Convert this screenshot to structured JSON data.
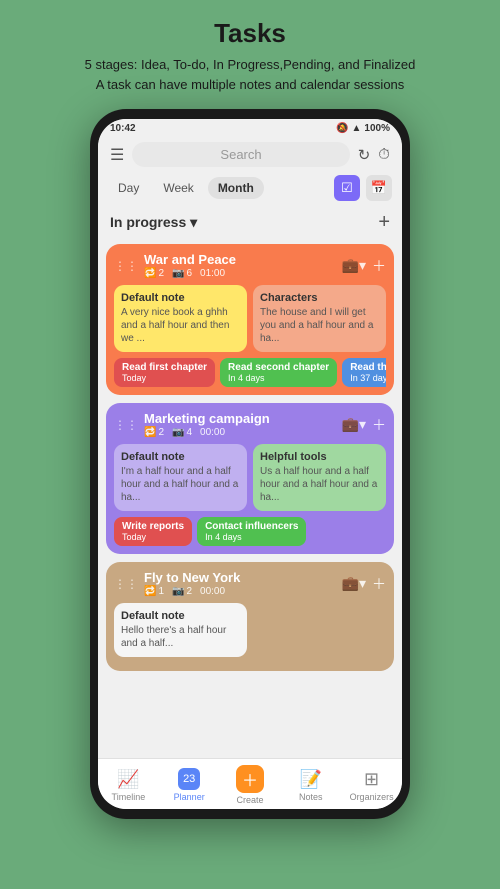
{
  "header": {
    "title": "Tasks",
    "subtitle_line1": "5 stages: Idea, To-do, In Progress,Pending, and Finalized",
    "subtitle_line2": "A task can have multiple notes and calendar sessions"
  },
  "status_bar": {
    "time": "10:42",
    "battery": "100%"
  },
  "top_bar": {
    "search_placeholder": "Search",
    "refresh_icon": "↻",
    "timer_icon": "⏱"
  },
  "date_tabs": {
    "tabs": [
      "Day",
      "Week",
      "Month"
    ],
    "active": "Month",
    "icons": [
      "☑",
      "📅"
    ]
  },
  "section": {
    "title": "In progress ▾",
    "add_icon": "+"
  },
  "tasks": [
    {
      "id": "war-and-peace",
      "name": "War and Peace",
      "color": "orange",
      "notes_count": "2",
      "sessions_count": "6",
      "time": "01:00",
      "notes": [
        {
          "title": "Default note",
          "text": "A very nice book a ghhh and a half hour and then we ...",
          "color": "yellow"
        },
        {
          "title": "Characters",
          "text": "The house and I will get you and a half hour and a ha...",
          "color": "salmon"
        }
      ],
      "sessions": [
        {
          "label": "Read first chapter",
          "sub": "Today",
          "color": "chip-red"
        },
        {
          "label": "Read second chapter",
          "sub": "In 4 days",
          "color": "chip-green"
        },
        {
          "label": "Read th...",
          "sub": "In 37 day...",
          "color": "chip-blue"
        }
      ]
    },
    {
      "id": "marketing-campaign",
      "name": "Marketing campaign",
      "color": "purple",
      "notes_count": "2",
      "sessions_count": "4",
      "time": "00:00",
      "notes": [
        {
          "title": "Default note",
          "text": "I'm a half hour and a half hour and a half hour and a ha...",
          "color": "light-purple"
        },
        {
          "title": "Helpful tools",
          "text": "Us a half hour and a half hour and a half hour and a ha...",
          "color": "light-green"
        }
      ],
      "sessions": [
        {
          "label": "Write reports",
          "sub": "Today",
          "color": "chip-red"
        },
        {
          "label": "Contact influencers",
          "sub": "In 4 days",
          "color": "chip-green"
        }
      ]
    },
    {
      "id": "fly-to-new-york",
      "name": "Fly to New York",
      "color": "brown",
      "notes_count": "1",
      "sessions_count": "2",
      "time": "00:00",
      "notes": [
        {
          "title": "Default note",
          "text": "Hello there's a half hour and a half...",
          "color": "white-ish"
        }
      ],
      "sessions": []
    }
  ],
  "bottom_nav": [
    {
      "label": "Timeline",
      "icon": "📈",
      "active": false
    },
    {
      "label": "Planner",
      "icon": "📅",
      "active": true
    },
    {
      "label": "Create",
      "icon": "+",
      "active": false
    },
    {
      "label": "Notes",
      "icon": "📝",
      "active": false
    },
    {
      "label": "Organizers",
      "icon": "⊞",
      "active": false
    }
  ]
}
